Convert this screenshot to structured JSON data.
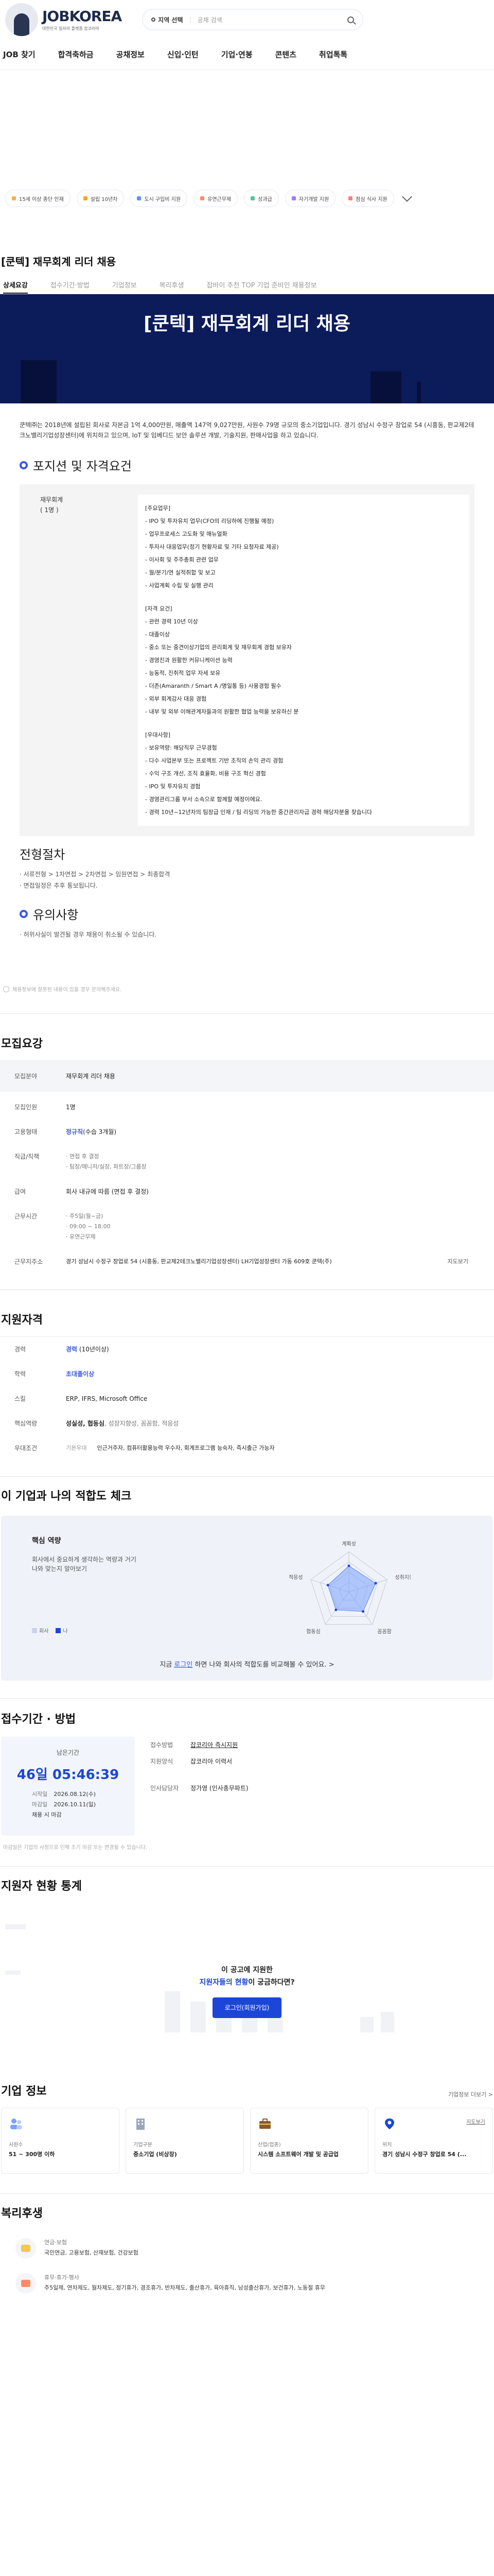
{
  "header": {
    "brand": "JOBKOREA",
    "tagline": "대한민국 일자리 플랫폼 잡코리아",
    "region_label": "지역 선택",
    "search_placeholder": "공채 검색"
  },
  "nav": [
    "JOB 찾기",
    "합격축하금",
    "공채정보",
    "신입·인턴",
    "기업·연봉",
    "콘텐츠",
    "취업톡톡"
  ],
  "chips": [
    {
      "label": "15세 이상 종단 인재",
      "color": "#f2b24b"
    },
    {
      "label": "설립 10년차",
      "color": "#f5a623"
    },
    {
      "label": "도시 구입비 지원",
      "color": "#5f8cff"
    },
    {
      "label": "유연근무제",
      "color": "#ff8a65"
    },
    {
      "label": "성과급",
      "color": "#53c68c"
    },
    {
      "label": "자기개발 지원",
      "color": "#9b7bff"
    },
    {
      "label": "점심 식사 지원",
      "color": "#ff7b7b"
    }
  ],
  "job": {
    "title": "[쿤텍] 재무회계 리더 채용",
    "tabs": [
      "상세요강",
      "접수기간·방법",
      "기업정보",
      "복리후생",
      "잡바이 추천 TOP 기업 준비인 채용정보"
    ],
    "banner_title": "[쿤텍] 재무회계 리더 채용",
    "intro": "쿤텍㈜는 2018년에 설립된 회사로 자본금 1억 4,000만원, 매출액 147억 9,027만원, 사원수 79명 규모의 중소기업입니다. 경기 성남시 수정구 창업로 54 (시흥동, 판교제2테크노밸리기업성장센터)에 위치하고 있으며, IoT 및 임베디드 보안 솔루션 개발, 기술지원, 판매사업을 하고 있습니다.",
    "position_heading": "포지션 및 자격요건",
    "position_name": "재무회계",
    "position_count": "( 1명 )",
    "duties_title": "[주요업무]",
    "duties": [
      "- IPO 및 투자유치 업무(CFO의 리딩하에 진행될 예정)",
      "- 업무프로세스 고도화 및 매뉴얼화",
      "- 투자사 대응업무(정기 현황자료 및 기타 요청자료 제공)",
      "- 이사회 및 주주총회 관련 업무",
      "- 월/분기/연 실적취합 및 보고",
      "- 사업계획 수립 및 실행 관리"
    ],
    "qual_title": "[자격 요건]",
    "quals": [
      "- 관련 경력 10년 이상",
      "- 대졸이상",
      "- 중소 또는 중견이상기업의 관리회계 및 재무회계 경험 보유자",
      "- 경영진과 원활한 커뮤니케이션 능력",
      "- 능동적, 진취적 업무 자세 보유",
      "- 더존(Amaranth / Smart A /명일통 등) 사용경험 필수",
      "- 외부 회계감사 대응 경험",
      "- 내부 및 외부 이해관계자들과의 원활한 협업 능력을 보유하신 분"
    ],
    "pref_title": "[우대사항]",
    "prefs": [
      "- 보유역량: 해당직무 근무경험",
      "- 다수 사업본부 또는 프로젝트 기반 조직의 손익 관리 경험",
      "- 수익 구조 개선, 조직 효율화, 비용 구조 혁신 경험",
      "- IPO 및 투자유치 경험",
      "- 경영관리그룹 부서 소속으로 함께할 예정이에요.",
      "- 경력 10년~12년차의 팀장급 인재 / 팀 리딩의 가능한 중간관리자급 경력 해당자분을 찾습니다"
    ],
    "process_heading": "전형절차",
    "process_steps": "· 서류전형 > 1차면접 > 2차면접 > 임원면접 > 최종합격",
    "process_note": "· 면접일정은 추후 통보됩니다.",
    "caution_heading": "유의사항",
    "caution_text": "· 허위사실이 발견될 경우 채용이 취소될 수 있습니다.",
    "disclaimer": "채용정보에 잘못된 내용이 있을 경우 문의해주세요."
  },
  "recruit": {
    "heading": "모집요강",
    "rows": {
      "field_k": "모집분야",
      "field_v": "재무회계 리더 채용",
      "count_k": "모집인원",
      "count_v": "1명",
      "type_k": "고용형태",
      "type_v": "정규직",
      "type_note": "(수습 3개월)",
      "rank_k": "직급/직책",
      "rank_v1": "· 면접 후 결정",
      "rank_v2": "· 팀장/매니저/실장, 파트장/그룹장",
      "pay_k": "급여",
      "pay_v": "회사 내규에 따름 (면접 후 결정)",
      "hours_k": "근무시간",
      "hours_v1": "· 주5일(월~금)",
      "hours_v2": "· 09:00 ~ 18:00",
      "hours_v3": "· 유연근무제",
      "addr_k": "근무지주소",
      "addr_v": "경기 성남시 수정구 창업로 54 (시흥동, 판교제2테크노밸리기업성장센터) LH기업성장센터 가동 609호 쿤텍(주)",
      "addr_link": "지도보기"
    }
  },
  "qualifications": {
    "heading": "지원자격",
    "career_k": "경력",
    "career_v": "경력",
    "career_note": "(10년이상)",
    "edu_k": "학력",
    "edu_v": "초대졸이상",
    "skill_k": "스킬",
    "skill_v": "ERP, IFRS, Microsoft Office",
    "core_k": "핵심역량",
    "core_v": "성실성, 협동심",
    "core_v2": ", 성장지향성, 꼼꼼함, 적응성",
    "pref_k": "우대조건",
    "pref_label": "기본우대",
    "pref_v": "인근거주자, 컴퓨터활용능력 우수자, 회계프로그램 능숙자, 즉시출근 가능자"
  },
  "fit": {
    "heading": "이 기업과 나의 적합도 체크",
    "title": "핵심 역량",
    "desc1": "회사에서 중요하게 생각하는 역량과 거기",
    "desc2": "나와 맞는지 알아보기",
    "axes": [
      "계획성",
      "성취지향성",
      "꼼꼼함",
      "협동심",
      "적응성"
    ],
    "legend_company": "회사",
    "legend_me": "나",
    "company_values": [
      0.65,
      0.7,
      0.6,
      0.55,
      0.55
    ],
    "bottom_pre": "지금 ",
    "bottom_link": "로그인",
    "bottom_post": " 하면 나와 회사의 적합도를 비교해볼 수 있어요. >"
  },
  "period": {
    "heading": "접수기간 · 방법",
    "remaining_label": "남은기간",
    "remaining": "46일 05:46:39",
    "start_k": "시작일",
    "start_v": "2026.08.12(수)",
    "end_k": "마감일",
    "end_v": "2026.10.11(일)",
    "end_note": "채용 시 마감",
    "method_k": "접수방법",
    "method_v": "잡코리아 즉시지원",
    "form_k": "지원양식",
    "form_v": "잡코리아 이력서",
    "hr_k": "인사담당자",
    "hr_v": "정가영 (인사총무파트)",
    "note": "마감일은 기업의 사정으로 인해 조기 마감 또는 변경될 수 있습니다."
  },
  "stats": {
    "heading": "지원자 현황 통계",
    "cta1": "이 공고에 지원한",
    "cta2_hl": "지원자들의 현황",
    "cta2_post": "이 궁금하다면?",
    "button": "로그인(회원가입)"
  },
  "company": {
    "heading": "기업 정보",
    "more": "기업정보 더보기 >",
    "cards": [
      {
        "k": "사원수",
        "v": "51 ~ 300명 이하",
        "icon": "people-icon"
      },
      {
        "k": "기업구분",
        "v": "중소기업 (비상장)",
        "icon": "building-icon"
      },
      {
        "k": "산업(업종)",
        "v": "시스템 소프트웨어 개발 및 공급업",
        "icon": "briefcase-icon"
      },
      {
        "k": "위치",
        "v": "경기 성남시 수정구 창업로 54 (...",
        "icon": "location-icon",
        "link": "지도보기"
      }
    ]
  },
  "welfare": {
    "heading": "복리후생",
    "items": [
      {
        "k": "연금·보험",
        "v": "국민연금, 고용보험, 산재보험, 건강보험"
      },
      {
        "k": "휴무·휴가·행사",
        "v": "주5일제, 연차제도, 월차제도, 정기휴가, 경조휴가, 반차제도, 출산휴가, 육아휴직, 남성출산휴가, 보건휴가, 노동절 휴무"
      }
    ]
  }
}
